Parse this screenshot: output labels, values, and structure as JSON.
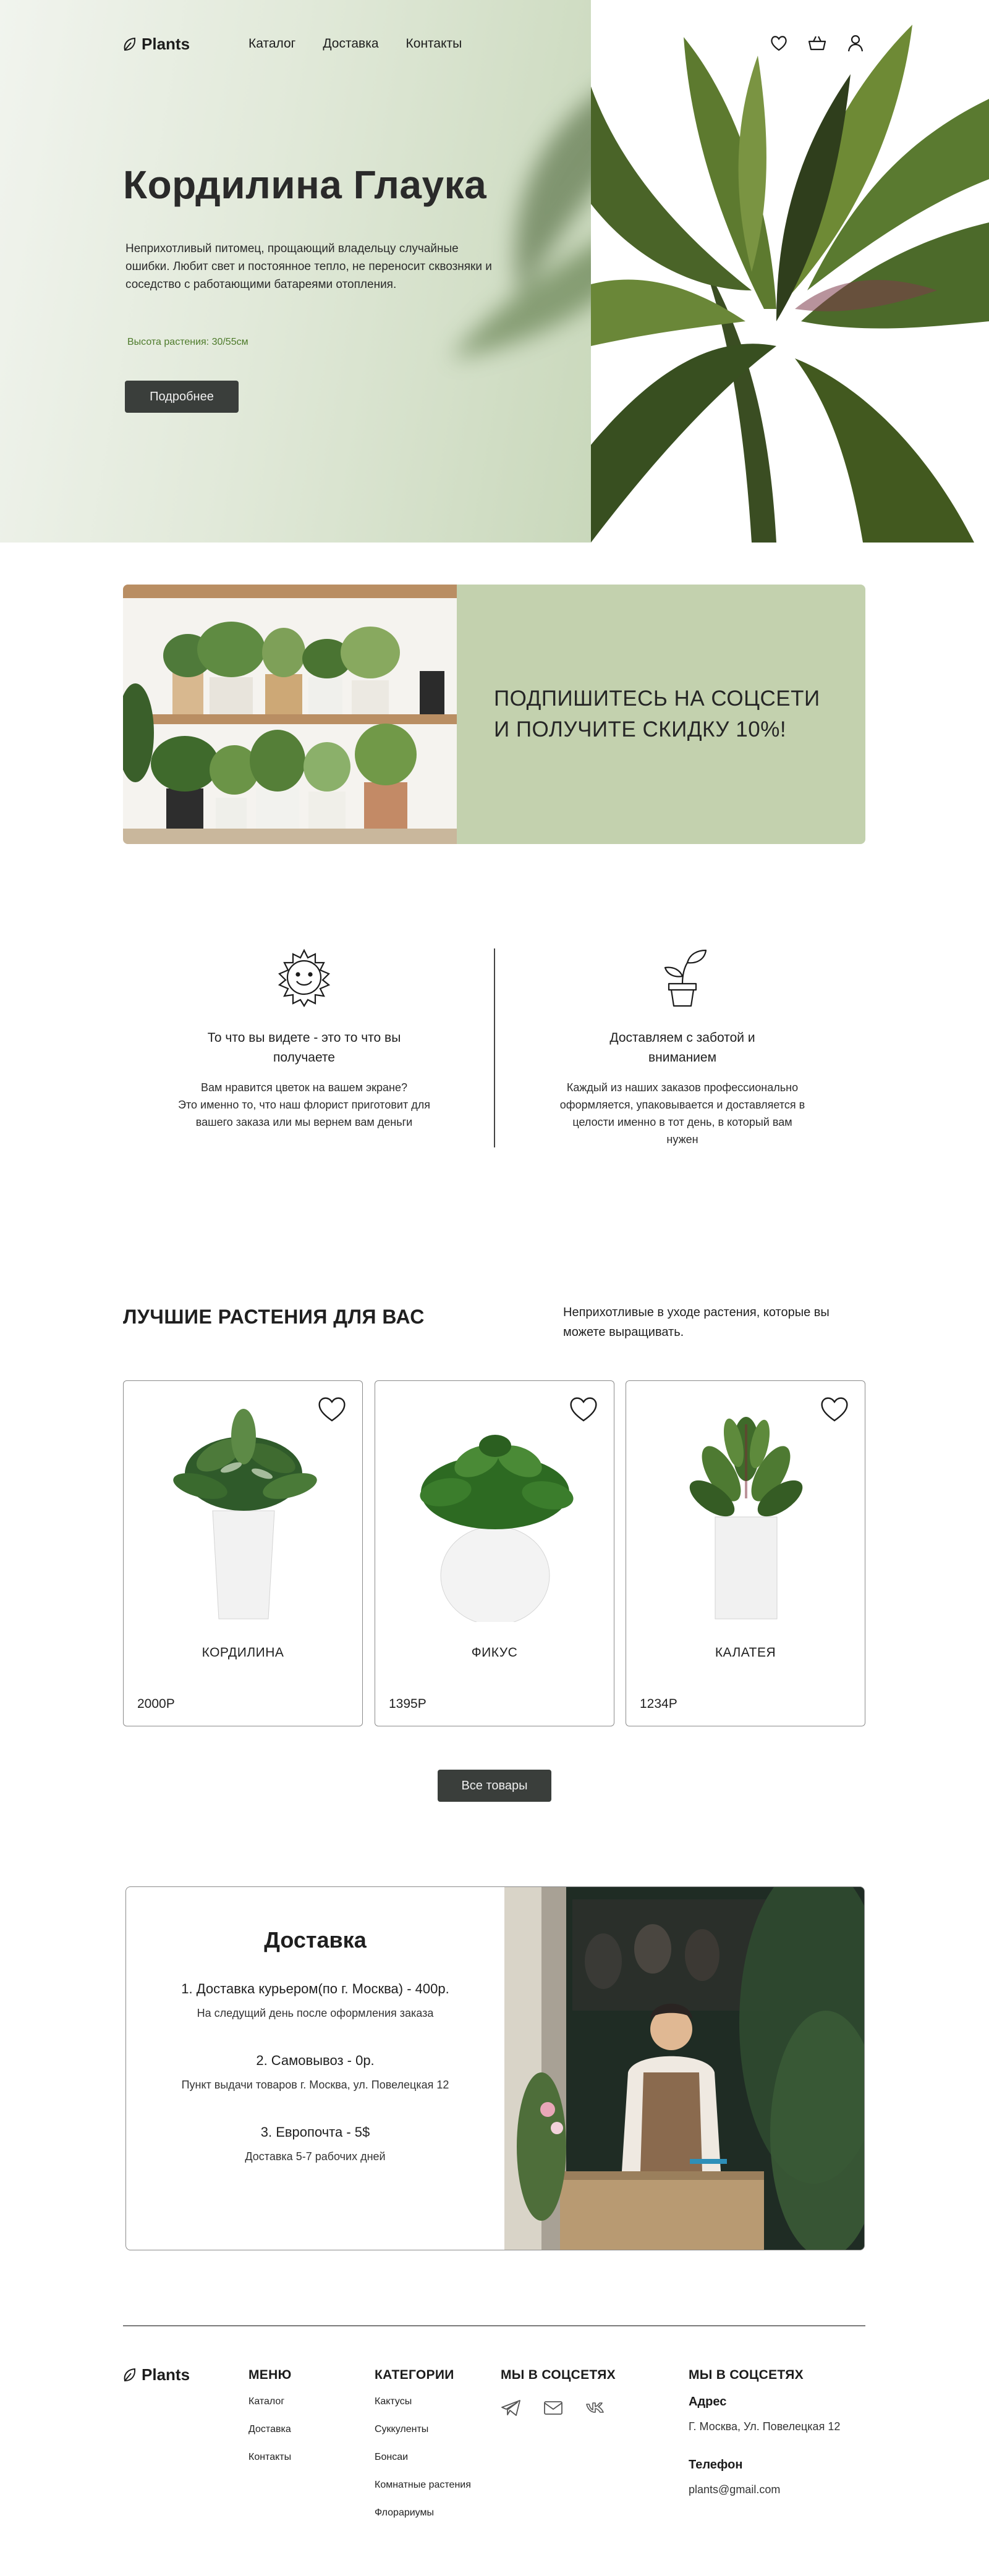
{
  "brand": {
    "name": "Plants",
    "icon": "leaf-icon",
    "accent": "#4d7a2a",
    "dark_button": "#3a3e3b",
    "promo_bg": "#c3d1ae"
  },
  "nav": {
    "links": [
      "Каталог",
      "Доставка",
      "Контакты"
    ],
    "icons": [
      "heart-icon",
      "basket-icon",
      "user-icon"
    ]
  },
  "hero": {
    "title": "Кордилина Глаука",
    "description": "Неприхотливый питомец, прощающий владельцу случайные ошибки. Любит свет и постоянное тепло, не переносит сквозняки и соседство с работающими батареями отопления.",
    "height": "Высота растения: 30/55см",
    "button": "Подробнее"
  },
  "promo": {
    "line1": "ПОДПИШИТЕСЬ НА СОЦСЕТИ",
    "line2": "И ПОЛУЧИТЕ СКИДКУ 10%!"
  },
  "features": [
    {
      "icon": "sun-icon",
      "title_line1": "То что вы видете - это то что вы",
      "title_line2": "получаете",
      "text_line1": "Вам нравится цветок на вашем экране?",
      "text_line2": "Это именно то, что наш флорист приготовит для",
      "text_line3": "вашего заказа или мы вернем вам деньги",
      "text_line4": ""
    },
    {
      "icon": "potted-plant-icon",
      "title_line1": "Доставляем с заботой и",
      "title_line2": "вниманием",
      "text_line1": "Каждый из наших заказов профессионально",
      "text_line2": "оформляется, упаковывается и доставляется в",
      "text_line3": "целости именно в тот день, в который вам",
      "text_line4": "нужен"
    }
  ],
  "best": {
    "title": "ЛУЧШИЕ РАСТЕНИЯ ДЛЯ ВАС",
    "subtitle": "Неприхотливые в уходе растения, которые вы можете выращивать.",
    "products": [
      {
        "name": "КОРДИЛИНА",
        "price": "2000Р"
      },
      {
        "name": "ФИКУС",
        "price": "1395Р"
      },
      {
        "name": "КАЛАТЕЯ",
        "price": "1234Р"
      }
    ],
    "all_button": "Все товары"
  },
  "delivery": {
    "title": "Доставка",
    "items": [
      {
        "head": "1. Доставка курьером(по г. Москва) - 400р.",
        "note": "На следущий день после оформления заказа"
      },
      {
        "head": "2. Самовывоз - 0р.",
        "note": "Пункт выдачи товаров г. Москва, ул. Повелецкая 12"
      },
      {
        "head": "3. Европочта - 5$",
        "note": "Доставка 5-7 рабочих дней"
      }
    ]
  },
  "footer": {
    "logo": "Plants",
    "menu": {
      "head": "МЕНЮ",
      "items": [
        "Каталог",
        "Доставка",
        "Контакты"
      ]
    },
    "categories": {
      "head": "КАТЕГОРИИ",
      "items": [
        "Кактусы",
        "Суккуленты",
        "Бонсаи",
        "Комнатные растения",
        "Флорариумы"
      ]
    },
    "social": {
      "head": "МЫ В СОЦСЕТЯХ",
      "icons": [
        "telegram-icon",
        "mail-icon",
        "vk-icon"
      ]
    },
    "contacts": {
      "head": "МЫ В СОЦСЕТЯХ",
      "address_label": "Адрес",
      "address": "Г. Москва, Ул. Повелецкая 12",
      "phone_label": "Телефон",
      "email": "plants@gmail.com"
    }
  }
}
